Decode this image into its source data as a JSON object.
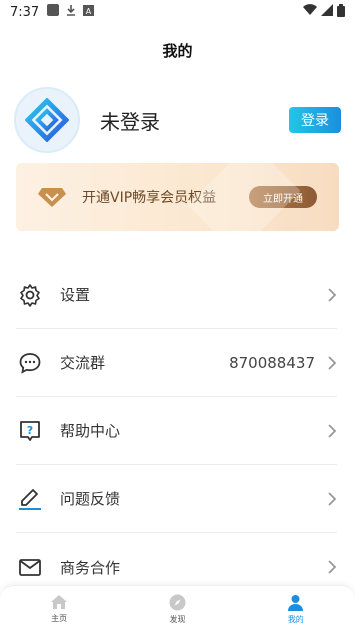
{
  "status_bar": {
    "time": "7:37"
  },
  "page": {
    "title": "我的"
  },
  "profile": {
    "name": "未登录",
    "login_label": "登录"
  },
  "vip": {
    "text": "开通VIP畅享会员权益",
    "button_label": "立即开通"
  },
  "menu": {
    "items": [
      {
        "label": "设置",
        "icon": "gear-icon",
        "value": ""
      },
      {
        "label": "交流群",
        "icon": "chat-icon",
        "value": "870088437"
      },
      {
        "label": "帮助中心",
        "icon": "help-icon",
        "value": ""
      },
      {
        "label": "问题反馈",
        "icon": "pen-icon",
        "value": ""
      },
      {
        "label": "商务合作",
        "icon": "mail-icon",
        "value": ""
      }
    ]
  },
  "tabbar": {
    "tabs": [
      {
        "label": "主页",
        "icon": "home-icon"
      },
      {
        "label": "发现",
        "icon": "compass-icon"
      },
      {
        "label": "我的",
        "icon": "user-icon"
      }
    ],
    "active": 2
  },
  "colors": {
    "accent": "#1a8fe0",
    "vip_text": "#6b4a2a",
    "vip_button": "#8c5a33"
  }
}
